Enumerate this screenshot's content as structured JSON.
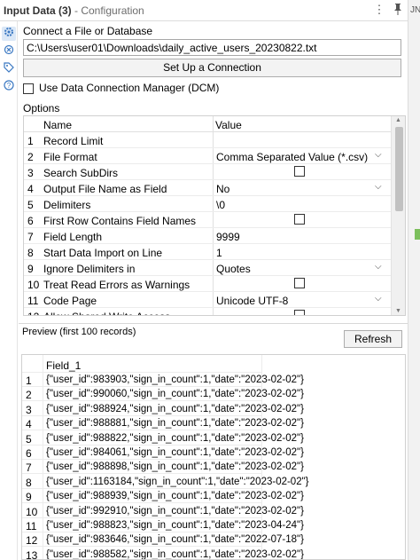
{
  "titlebar": {
    "tool_name": "Input Data (3)",
    "sub": " - Configuration",
    "icons": [
      "more-vertical-icon",
      "pin-icon"
    ],
    "edge_fragment": "JN"
  },
  "rail": {
    "icons": [
      "gear-icon",
      "connection-icon",
      "tag-icon",
      "help-icon"
    ]
  },
  "connect": {
    "label": "Connect a File or Database",
    "path": "C:\\Users\\user01\\Downloads\\daily_active_users_20230822.txt",
    "setup_button": "Set Up a Connection",
    "dcm_label": "Use Data Connection Manager (DCM)"
  },
  "options": {
    "label": "Options",
    "col_name": "Name",
    "col_value": "Value",
    "rows": [
      {
        "num": "1",
        "name": "Record Limit",
        "value": "",
        "kind": "text"
      },
      {
        "num": "2",
        "name": "File Format",
        "value": "Comma Separated Value (*.csv)",
        "kind": "dropdown"
      },
      {
        "num": "3",
        "name": "Search SubDirs",
        "value": "",
        "kind": "checkbox"
      },
      {
        "num": "4",
        "name": "Output File Name as Field",
        "value": "No",
        "kind": "dropdown"
      },
      {
        "num": "5",
        "name": "Delimiters",
        "value": "\\0",
        "kind": "text"
      },
      {
        "num": "6",
        "name": "First Row Contains Field Names",
        "value": "",
        "kind": "checkbox"
      },
      {
        "num": "7",
        "name": "Field Length",
        "value": "9999",
        "kind": "text"
      },
      {
        "num": "8",
        "name": "Start Data Import on Line",
        "value": "1",
        "kind": "text"
      },
      {
        "num": "9",
        "name": "Ignore Delimiters in",
        "value": "Quotes",
        "kind": "dropdown"
      },
      {
        "num": "10",
        "name": "Treat Read Errors as Warnings",
        "value": "",
        "kind": "checkbox"
      },
      {
        "num": "11",
        "name": "Code Page",
        "value": "Unicode UTF-8",
        "kind": "dropdown"
      },
      {
        "num": "12",
        "name": "Allow Shared Write Access",
        "value": "",
        "kind": "checkbox"
      }
    ]
  },
  "preview": {
    "label": "Preview (first 100 records)",
    "refresh_button": "Refresh",
    "column": "Field_1",
    "rows": [
      {
        "num": "1",
        "text": "{\"user_id\":983903,\"sign_in_count\":1,\"date\":\"2023-02-02\"}"
      },
      {
        "num": "2",
        "text": "{\"user_id\":990060,\"sign_in_count\":1,\"date\":\"2023-02-02\"}"
      },
      {
        "num": "3",
        "text": "{\"user_id\":988924,\"sign_in_count\":1,\"date\":\"2023-02-02\"}"
      },
      {
        "num": "4",
        "text": "{\"user_id\":988881,\"sign_in_count\":1,\"date\":\"2023-02-02\"}"
      },
      {
        "num": "5",
        "text": "{\"user_id\":988822,\"sign_in_count\":1,\"date\":\"2023-02-02\"}"
      },
      {
        "num": "6",
        "text": "{\"user_id\":984061,\"sign_in_count\":1,\"date\":\"2023-02-02\"}"
      },
      {
        "num": "7",
        "text": "{\"user_id\":988898,\"sign_in_count\":1,\"date\":\"2023-02-02\"}"
      },
      {
        "num": "8",
        "text": "{\"user_id\":1163184,\"sign_in_count\":1,\"date\":\"2023-02-02\"}"
      },
      {
        "num": "9",
        "text": "{\"user_id\":988939,\"sign_in_count\":1,\"date\":\"2023-02-02\"}"
      },
      {
        "num": "10",
        "text": "{\"user_id\":992910,\"sign_in_count\":1,\"date\":\"2023-02-02\"}"
      },
      {
        "num": "11",
        "text": "{\"user_id\":988823,\"sign_in_count\":1,\"date\":\"2023-04-24\"}"
      },
      {
        "num": "12",
        "text": "{\"user_id\":983646,\"sign_in_count\":1,\"date\":\"2022-07-18\"}"
      },
      {
        "num": "13",
        "text": "{\"user_id\":988582,\"sign_in_count\":1,\"date\":\"2023-02-02\"}"
      }
    ]
  },
  "colors": {
    "accent": "#3a78c2",
    "border": "#d0d0d0",
    "button_bg": "#f3f3f3"
  }
}
